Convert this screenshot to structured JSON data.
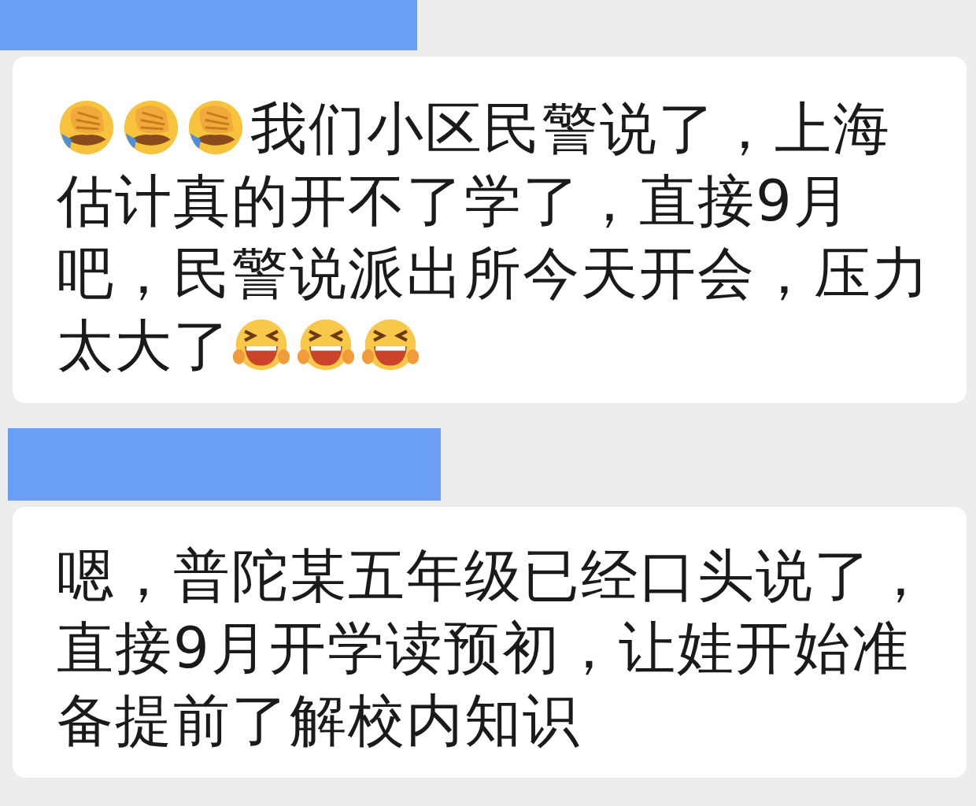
{
  "messages": [
    {
      "redacted_sender": true,
      "content": [
        {
          "kind": "facepalm"
        },
        {
          "kind": "facepalm"
        },
        {
          "kind": "facepalm"
        },
        {
          "kind": "text",
          "text": "我们小区民警说了，上海"
        },
        {
          "kind": "text",
          "text": "估计真的开不了学了，直接9月吧，民警说派出所今天开会，压力"
        },
        {
          "kind": "text",
          "text": "太大了"
        },
        {
          "kind": "laugh"
        },
        {
          "kind": "laugh"
        },
        {
          "kind": "laugh"
        }
      ]
    },
    {
      "redacted_sender": true,
      "content": [
        {
          "kind": "text",
          "text": "嗯，普陀某五年级已经口头说了，直接9月开学读预初，让娃开始准备提前了解校内知识"
        }
      ]
    }
  ]
}
